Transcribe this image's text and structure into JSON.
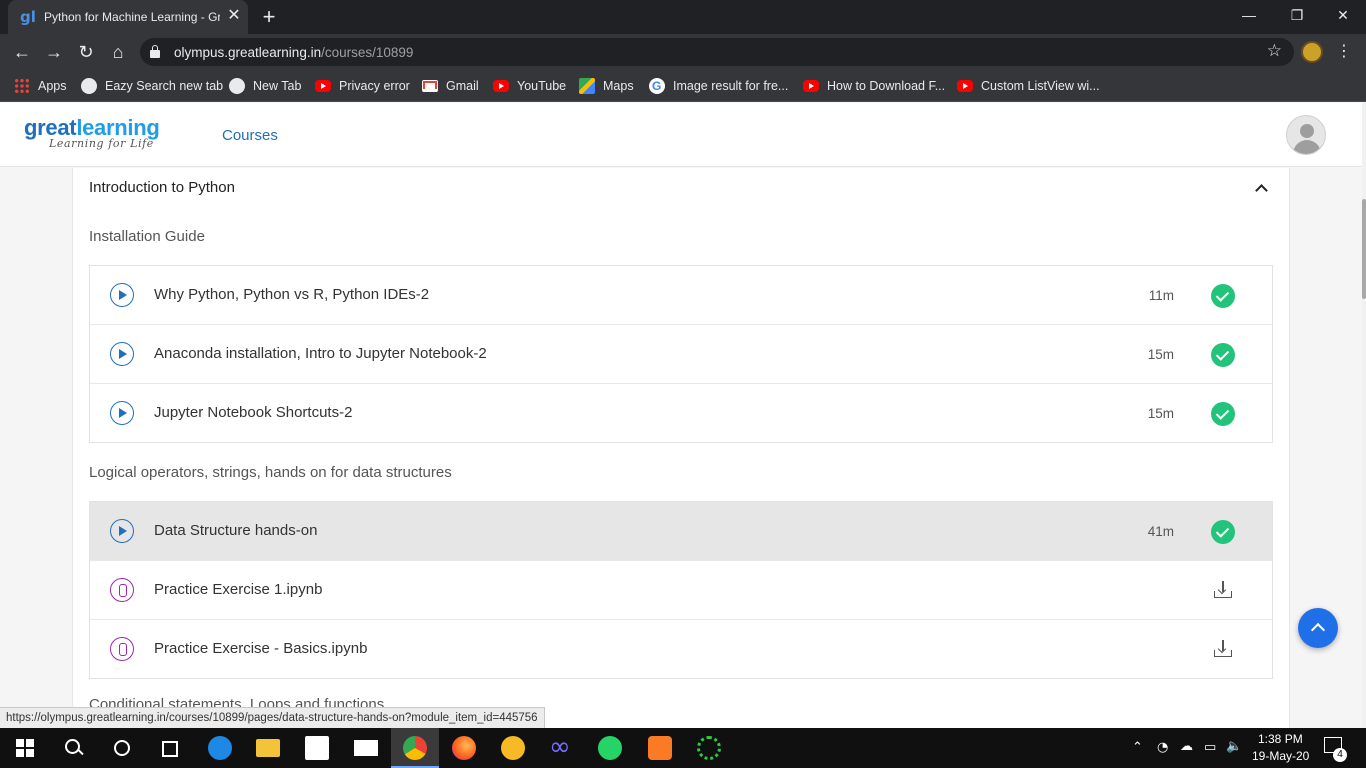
{
  "browser": {
    "tab_title": "Python for Machine Learning - Gr",
    "url_domain": "olympus.greatlearning.in",
    "url_path": "/courses/10899",
    "bookmarks": [
      {
        "label": "Apps",
        "icon": "apps-grid-icon"
      },
      {
        "label": "Eazy Search new tab",
        "icon": "globe-icon"
      },
      {
        "label": "New Tab",
        "icon": "globe-icon"
      },
      {
        "label": "Privacy error",
        "icon": "youtube-icon"
      },
      {
        "label": "Gmail",
        "icon": "gmail-icon"
      },
      {
        "label": "YouTube",
        "icon": "youtube-icon"
      },
      {
        "label": "Maps",
        "icon": "maps-icon"
      },
      {
        "label": "Image result for fre...",
        "icon": "google-icon"
      },
      {
        "label": "How to Download F...",
        "icon": "youtube-icon"
      },
      {
        "label": "Custom ListView wi...",
        "icon": "youtube-icon"
      }
    ],
    "status_url": "https://olympus.greatlearning.in/courses/10899/pages/data-structure-hands-on?module_item_id=445756"
  },
  "site": {
    "logo_main_dark": "great",
    "logo_main_light": "learning",
    "logo_tagline": "Learning for Life",
    "nav_courses": "Courses"
  },
  "module": {
    "title": "Introduction to Python",
    "sections": [
      {
        "label": "Installation Guide",
        "items": [
          {
            "type": "video",
            "label": "Why Python, Python vs R, Python IDEs-2",
            "duration": "11m",
            "completed": true
          },
          {
            "type": "video",
            "label": "Anaconda installation, Intro to Jupyter Notebook-2",
            "duration": "15m",
            "completed": true
          },
          {
            "type": "video",
            "label": "Jupyter Notebook Shortcuts-2",
            "duration": "15m",
            "completed": true
          }
        ]
      },
      {
        "label": "Logical operators, strings, hands on for data structures",
        "items": [
          {
            "type": "video",
            "label": "Data Structure hands-on",
            "duration": "41m",
            "completed": true,
            "hovered": true
          },
          {
            "type": "file",
            "label": "Practice Exercise 1.ipynb",
            "action": "download"
          },
          {
            "type": "file",
            "label": "Practice Exercise - Basics.ipynb",
            "action": "download"
          }
        ]
      },
      {
        "label": "Conditional statements, Loops and functions"
      }
    ]
  },
  "taskbar": {
    "time": "1:38 PM",
    "date": "19-May-20",
    "notification_count": "4"
  },
  "colors": {
    "brand_blue": "#1f6fbf",
    "complete_green": "#22c37a",
    "file_purple": "#9c27b0"
  }
}
